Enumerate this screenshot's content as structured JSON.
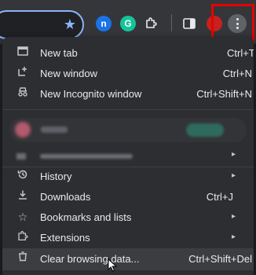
{
  "toolbar": {
    "omnibox_icon": "star-icon",
    "extensions": [
      "n-extension-icon",
      "grammarly-icon",
      "puzzle-icon"
    ],
    "side_panel_icon": "side-panel-icon",
    "profile_icon": "profile-avatar-icon",
    "menu_icon": "three-dot-menu-icon",
    "highlight_color": "#e60000"
  },
  "menu": {
    "items": [
      {
        "label": "New tab",
        "shortcut": "Ctrl+T",
        "icon": "new-tab-icon"
      },
      {
        "label": "New window",
        "shortcut": "Ctrl+N",
        "icon": "new-window-icon"
      },
      {
        "label": "New Incognito window",
        "shortcut": "Ctrl+Shift+N",
        "icon": "incognito-icon"
      },
      {
        "label": "History",
        "icon": "history-icon"
      },
      {
        "label": "Downloads",
        "shortcut": "Ctrl+J",
        "icon": "download-icon"
      },
      {
        "label": "Bookmarks and lists",
        "icon": "star-icon"
      },
      {
        "label": "Extensions",
        "icon": "puzzle-icon"
      },
      {
        "label": "Clear browsing data...",
        "shortcut": "Ctrl+Shift+Del",
        "icon": "trash-icon"
      }
    ]
  },
  "colors": {
    "background": "#202124",
    "menu_bg": "#2d2e31",
    "accent": "#8ab4f8"
  }
}
